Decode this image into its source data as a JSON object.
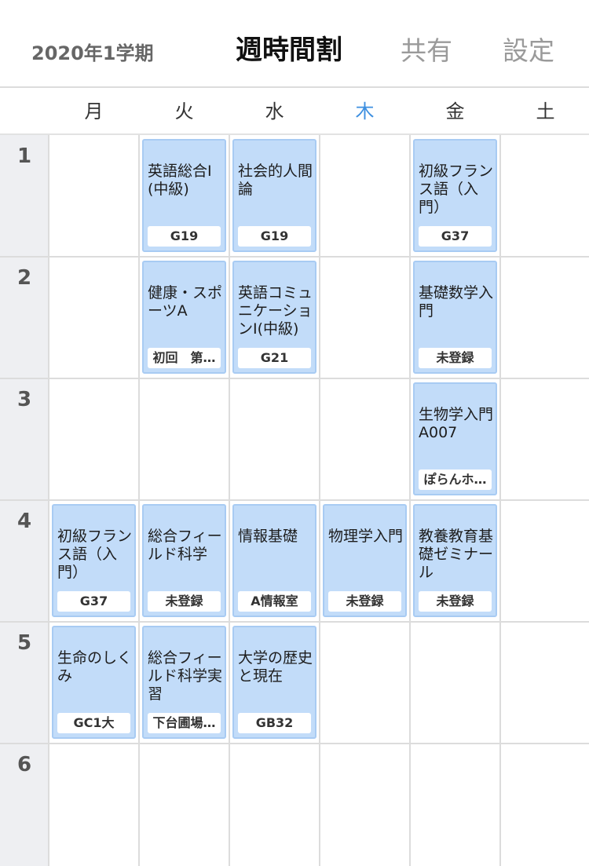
{
  "header": {
    "term": "2020年1学期",
    "title": "週時間割",
    "share_label": "共有",
    "settings_label": "設定"
  },
  "days": [
    "月",
    "火",
    "水",
    "木",
    "金",
    "土"
  ],
  "today_index": 3,
  "periods": [
    "1",
    "2",
    "3",
    "4",
    "5",
    "6"
  ],
  "courses": [
    {
      "day": 1,
      "period": 1,
      "name": "英語総合I(中級)",
      "room": "G19"
    },
    {
      "day": 2,
      "period": 1,
      "name": "社会的人間論",
      "room": "G19"
    },
    {
      "day": 4,
      "period": 1,
      "name": "初級フランス語（入門）",
      "room": "G37"
    },
    {
      "day": 1,
      "period": 2,
      "name": "健康・スポーツA",
      "room": "初回　第…"
    },
    {
      "day": 2,
      "period": 2,
      "name": "英語コミュニケーションI(中級)",
      "room": "G21"
    },
    {
      "day": 4,
      "period": 2,
      "name": "基礎数学入門",
      "room": "未登録"
    },
    {
      "day": 4,
      "period": 3,
      "name": "生物学入門A007",
      "room": "ぽらんホ…"
    },
    {
      "day": 0,
      "period": 4,
      "name": "初級フランス語（入門）",
      "room": "G37"
    },
    {
      "day": 1,
      "period": 4,
      "name": "総合フィールド科学",
      "room": "未登録"
    },
    {
      "day": 2,
      "period": 4,
      "name": "情報基礎",
      "room": "A情報室"
    },
    {
      "day": 3,
      "period": 4,
      "name": "物理学入門",
      "room": "未登録"
    },
    {
      "day": 4,
      "period": 4,
      "name": "教養教育基礎ゼミナール",
      "room": "未登録"
    },
    {
      "day": 0,
      "period": 5,
      "name": "生命のしくみ",
      "room": "GC1大"
    },
    {
      "day": 1,
      "period": 5,
      "name": "総合フィールド科学実習",
      "room": "下台圃場…"
    },
    {
      "day": 2,
      "period": 5,
      "name": "大学の歴史と現在",
      "room": "GB32"
    }
  ]
}
